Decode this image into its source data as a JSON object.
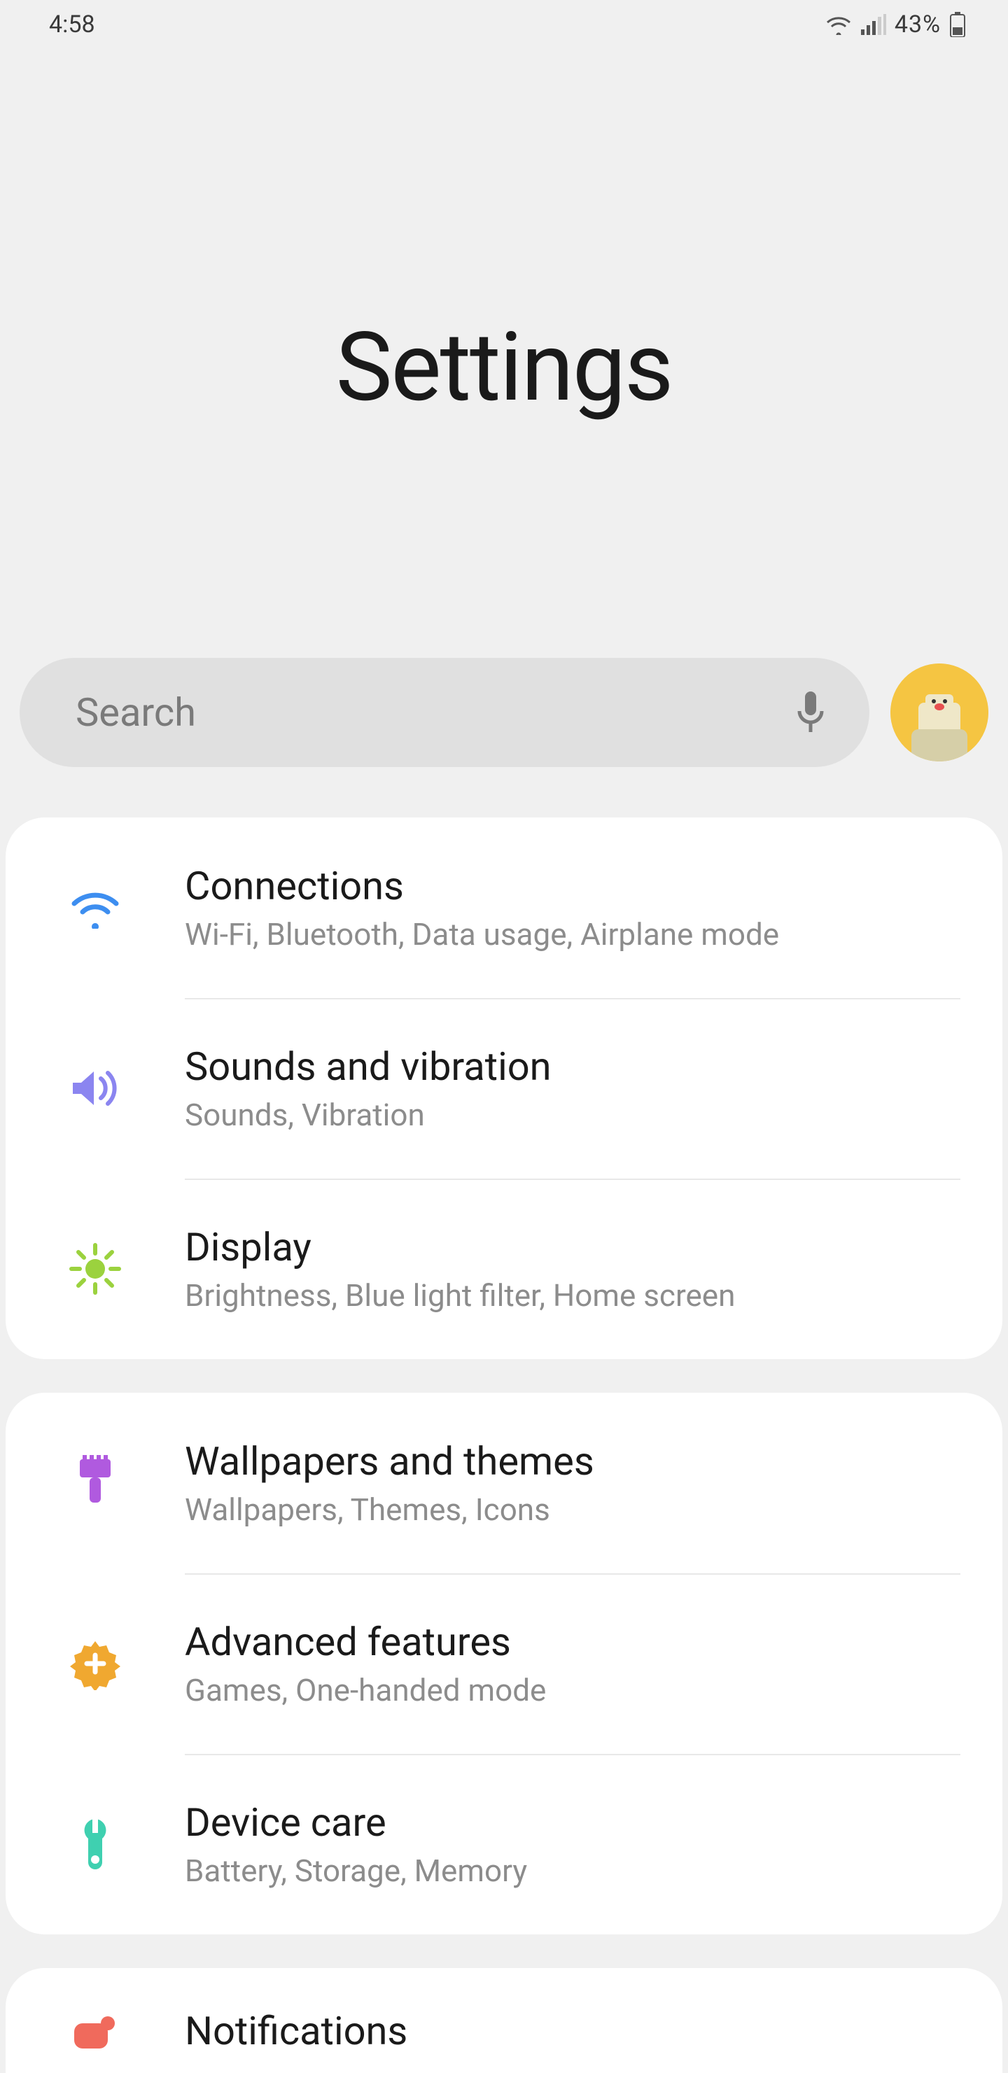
{
  "status_bar": {
    "time": "4:58",
    "battery_pct": "43%"
  },
  "header": {
    "title": "Settings"
  },
  "search": {
    "placeholder": "Search"
  },
  "groups": [
    {
      "items": [
        {
          "id": "connections",
          "title": "Connections",
          "subtitle": "Wi-Fi, Bluetooth, Data usage, Airplane mode",
          "icon": "wifi-icon",
          "color": "#3d8ef0"
        },
        {
          "id": "sounds-vibration",
          "title": "Sounds and vibration",
          "subtitle": "Sounds, Vibration",
          "icon": "sound-icon",
          "color": "#8b85f0"
        },
        {
          "id": "display",
          "title": "Display",
          "subtitle": "Brightness, Blue light filter, Home screen",
          "icon": "brightness-icon",
          "color": "#9bd23e"
        }
      ]
    },
    {
      "items": [
        {
          "id": "wallpapers-themes",
          "title": "Wallpapers and themes",
          "subtitle": "Wallpapers, Themes, Icons",
          "icon": "brush-icon",
          "color": "#b05adf"
        },
        {
          "id": "advanced-features",
          "title": "Advanced features",
          "subtitle": "Games, One-handed mode",
          "icon": "gear-plus-icon",
          "color": "#f0a830"
        },
        {
          "id": "device-care",
          "title": "Device care",
          "subtitle": "Battery, Storage, Memory",
          "icon": "wrench-icon",
          "color": "#3fd0b0"
        }
      ]
    },
    {
      "items": [
        {
          "id": "notifications",
          "title": "Notifications",
          "subtitle": "",
          "icon": "notification-icon",
          "color": "#f06a5c"
        }
      ]
    }
  ]
}
